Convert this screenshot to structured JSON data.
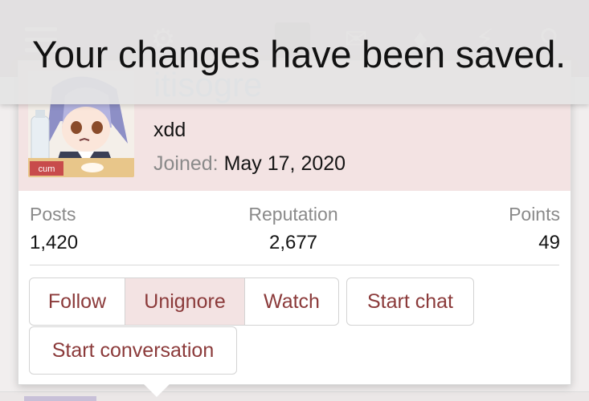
{
  "toast": {
    "message": "Your changes have been saved."
  },
  "appbar": {
    "icons": [
      "menu-icon",
      "logo-icon",
      "user-avatar",
      "mail-icon",
      "bell-icon",
      "bolt-icon",
      "search-icon"
    ]
  },
  "member": {
    "username": "itisogre",
    "title": "xdd",
    "joined_label": "Joined:",
    "joined_value": "May 17, 2020",
    "avatar_caption": "cum",
    "stats": {
      "posts_label": "Posts",
      "posts_value": "1,420",
      "reputation_label": "Reputation",
      "reputation_value": "2,677",
      "points_label": "Points",
      "points_value": "49"
    },
    "buttons": {
      "follow": "Follow",
      "unignore": "Unignore",
      "watch": "Watch",
      "start_chat": "Start chat",
      "start_conversation": "Start conversation"
    }
  },
  "colors": {
    "accent_text": "#8b3a3a",
    "card_header_bg": "#f3e3e3",
    "username": "#a9c7e4",
    "appbar_bg": "#c9aeb1"
  }
}
